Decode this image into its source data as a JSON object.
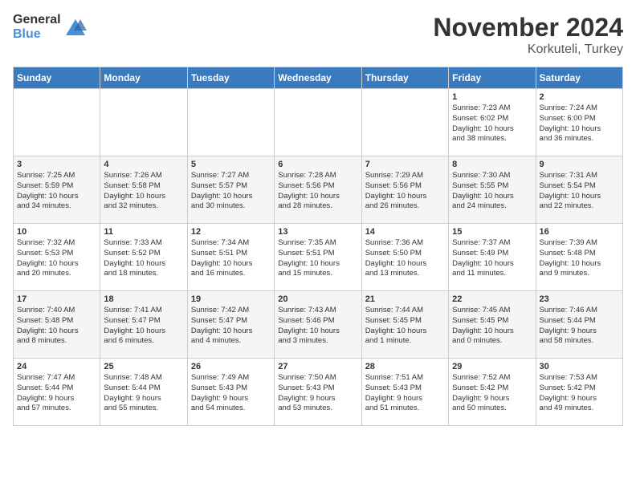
{
  "logo": {
    "general": "General",
    "blue": "Blue"
  },
  "header": {
    "month": "November 2024",
    "location": "Korkuteli, Turkey"
  },
  "days_of_week": [
    "Sunday",
    "Monday",
    "Tuesday",
    "Wednesday",
    "Thursday",
    "Friday",
    "Saturday"
  ],
  "weeks": [
    [
      {
        "day": "",
        "info": ""
      },
      {
        "day": "",
        "info": ""
      },
      {
        "day": "",
        "info": ""
      },
      {
        "day": "",
        "info": ""
      },
      {
        "day": "",
        "info": ""
      },
      {
        "day": "1",
        "info": "Sunrise: 7:23 AM\nSunset: 6:02 PM\nDaylight: 10 hours\nand 38 minutes."
      },
      {
        "day": "2",
        "info": "Sunrise: 7:24 AM\nSunset: 6:00 PM\nDaylight: 10 hours\nand 36 minutes."
      }
    ],
    [
      {
        "day": "3",
        "info": "Sunrise: 7:25 AM\nSunset: 5:59 PM\nDaylight: 10 hours\nand 34 minutes."
      },
      {
        "day": "4",
        "info": "Sunrise: 7:26 AM\nSunset: 5:58 PM\nDaylight: 10 hours\nand 32 minutes."
      },
      {
        "day": "5",
        "info": "Sunrise: 7:27 AM\nSunset: 5:57 PM\nDaylight: 10 hours\nand 30 minutes."
      },
      {
        "day": "6",
        "info": "Sunrise: 7:28 AM\nSunset: 5:56 PM\nDaylight: 10 hours\nand 28 minutes."
      },
      {
        "day": "7",
        "info": "Sunrise: 7:29 AM\nSunset: 5:56 PM\nDaylight: 10 hours\nand 26 minutes."
      },
      {
        "day": "8",
        "info": "Sunrise: 7:30 AM\nSunset: 5:55 PM\nDaylight: 10 hours\nand 24 minutes."
      },
      {
        "day": "9",
        "info": "Sunrise: 7:31 AM\nSunset: 5:54 PM\nDaylight: 10 hours\nand 22 minutes."
      }
    ],
    [
      {
        "day": "10",
        "info": "Sunrise: 7:32 AM\nSunset: 5:53 PM\nDaylight: 10 hours\nand 20 minutes."
      },
      {
        "day": "11",
        "info": "Sunrise: 7:33 AM\nSunset: 5:52 PM\nDaylight: 10 hours\nand 18 minutes."
      },
      {
        "day": "12",
        "info": "Sunrise: 7:34 AM\nSunset: 5:51 PM\nDaylight: 10 hours\nand 16 minutes."
      },
      {
        "day": "13",
        "info": "Sunrise: 7:35 AM\nSunset: 5:51 PM\nDaylight: 10 hours\nand 15 minutes."
      },
      {
        "day": "14",
        "info": "Sunrise: 7:36 AM\nSunset: 5:50 PM\nDaylight: 10 hours\nand 13 minutes."
      },
      {
        "day": "15",
        "info": "Sunrise: 7:37 AM\nSunset: 5:49 PM\nDaylight: 10 hours\nand 11 minutes."
      },
      {
        "day": "16",
        "info": "Sunrise: 7:39 AM\nSunset: 5:48 PM\nDaylight: 10 hours\nand 9 minutes."
      }
    ],
    [
      {
        "day": "17",
        "info": "Sunrise: 7:40 AM\nSunset: 5:48 PM\nDaylight: 10 hours\nand 8 minutes."
      },
      {
        "day": "18",
        "info": "Sunrise: 7:41 AM\nSunset: 5:47 PM\nDaylight: 10 hours\nand 6 minutes."
      },
      {
        "day": "19",
        "info": "Sunrise: 7:42 AM\nSunset: 5:47 PM\nDaylight: 10 hours\nand 4 minutes."
      },
      {
        "day": "20",
        "info": "Sunrise: 7:43 AM\nSunset: 5:46 PM\nDaylight: 10 hours\nand 3 minutes."
      },
      {
        "day": "21",
        "info": "Sunrise: 7:44 AM\nSunset: 5:45 PM\nDaylight: 10 hours\nand 1 minute."
      },
      {
        "day": "22",
        "info": "Sunrise: 7:45 AM\nSunset: 5:45 PM\nDaylight: 10 hours\nand 0 minutes."
      },
      {
        "day": "23",
        "info": "Sunrise: 7:46 AM\nSunset: 5:44 PM\nDaylight: 9 hours\nand 58 minutes."
      }
    ],
    [
      {
        "day": "24",
        "info": "Sunrise: 7:47 AM\nSunset: 5:44 PM\nDaylight: 9 hours\nand 57 minutes."
      },
      {
        "day": "25",
        "info": "Sunrise: 7:48 AM\nSunset: 5:44 PM\nDaylight: 9 hours\nand 55 minutes."
      },
      {
        "day": "26",
        "info": "Sunrise: 7:49 AM\nSunset: 5:43 PM\nDaylight: 9 hours\nand 54 minutes."
      },
      {
        "day": "27",
        "info": "Sunrise: 7:50 AM\nSunset: 5:43 PM\nDaylight: 9 hours\nand 53 minutes."
      },
      {
        "day": "28",
        "info": "Sunrise: 7:51 AM\nSunset: 5:43 PM\nDaylight: 9 hours\nand 51 minutes."
      },
      {
        "day": "29",
        "info": "Sunrise: 7:52 AM\nSunset: 5:42 PM\nDaylight: 9 hours\nand 50 minutes."
      },
      {
        "day": "30",
        "info": "Sunrise: 7:53 AM\nSunset: 5:42 PM\nDaylight: 9 hours\nand 49 minutes."
      }
    ]
  ]
}
